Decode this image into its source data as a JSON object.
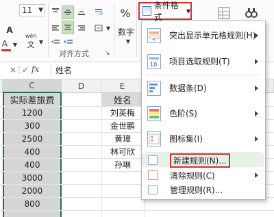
{
  "colors": {
    "accent_red": "#d0312d",
    "excel_green": "#217346",
    "selection": "#d6d6d6"
  },
  "ribbon": {
    "font_size": "11",
    "percent_label": "%",
    "number_label": "数字",
    "align_group_label": "对齐方式",
    "wen_label": "wén",
    "a_label": "A",
    "conditional_format": {
      "label": "条件格式",
      "icon": "conditional-format-icon"
    }
  },
  "formula_bar": {
    "fx": "fx",
    "cancel": "✓",
    "value": "姓名"
  },
  "grid": {
    "col_c": "C",
    "col_d": "D",
    "col_e": "E",
    "c_header": "实际差旅费",
    "c_values": [
      "1200",
      "300",
      "2500",
      "400",
      "400",
      "3000",
      "2000",
      "800"
    ],
    "e_header": "姓名",
    "e_values": [
      "刘英梅",
      "金世鹏",
      "黄璋",
      "林可欣",
      "孙琳"
    ]
  },
  "menu": {
    "items": [
      {
        "label": "突出显示单元格规则(H)",
        "icon": "highlight-rules-icon",
        "submenu": true
      },
      {
        "label": "项目选取规则(T)",
        "icon": "top-bottom-rules-icon",
        "submenu": true
      },
      {
        "label": "数据条(D)",
        "icon": "data-bars-icon",
        "submenu": true
      },
      {
        "label": "色阶(S)",
        "icon": "color-scales-icon",
        "submenu": true
      },
      {
        "label": "图标集(I)",
        "icon": "icon-sets-icon",
        "submenu": true
      }
    ],
    "new_rule": "新建规则(N)...",
    "clear_rules": "清除规则(C)",
    "manage_rules": "管理规则(R)..."
  }
}
